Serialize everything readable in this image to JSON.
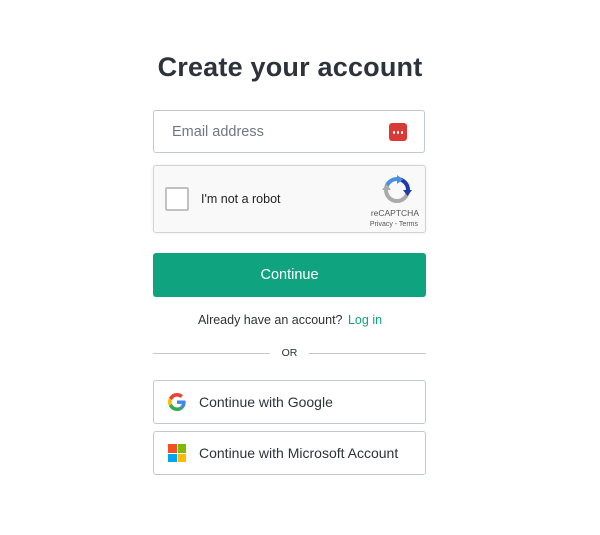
{
  "title": "Create your account",
  "email": {
    "placeholder": "Email address",
    "value": "",
    "icon": "password-manager-icon"
  },
  "recaptcha": {
    "label": "I'm not a robot",
    "brand": "reCAPTCHA",
    "terms": "Privacy - Terms",
    "icon": "recaptcha-logo-icon"
  },
  "continue_label": "Continue",
  "login_prompt": {
    "text": "Already have an account?",
    "link": "Log in"
  },
  "divider_label": "OR",
  "social": {
    "google_label": "Continue with Google",
    "microsoft_label": "Continue with Microsoft Account",
    "google_icon": "google-icon",
    "microsoft_icon": "microsoft-icon"
  },
  "colors": {
    "accent": "#10a37f",
    "text": "#2d333a",
    "border": "#c2c8d0",
    "password_icon": "#d93a35"
  }
}
